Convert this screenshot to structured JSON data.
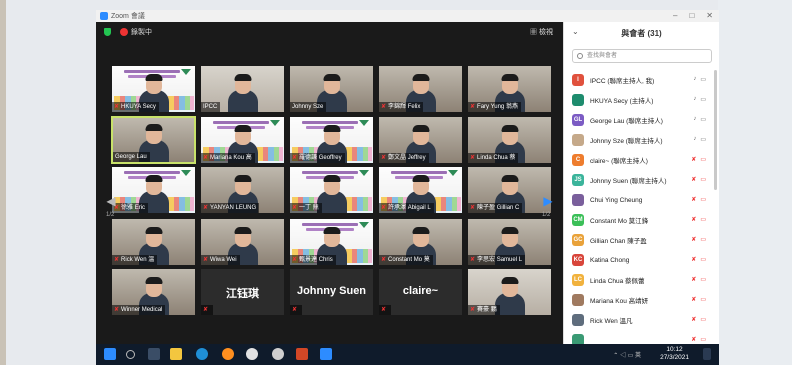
{
  "window": {
    "title": "Zoom 會議"
  },
  "toolbar": {
    "recording_label": "錄製中",
    "view_label": "檢視"
  },
  "pager": {
    "left": "1/2",
    "right": "1/2"
  },
  "tiles": [
    {
      "name": "HKUYA Secy",
      "muted": true,
      "kind": "slide"
    },
    {
      "name": "IPCC",
      "muted": false,
      "kind": "office"
    },
    {
      "name": "Johnny Sze",
      "muted": false,
      "kind": "person"
    },
    {
      "name": "李錦輝 Felix",
      "muted": true,
      "kind": "person"
    },
    {
      "name": "Fary Yung 翁燕",
      "muted": true,
      "kind": "person"
    },
    {
      "name": "George Lau",
      "muted": false,
      "kind": "person",
      "active": true
    },
    {
      "name": "Mariana Kou 高",
      "muted": true,
      "kind": "slide"
    },
    {
      "name": "羅德謙 Geoffrey",
      "muted": true,
      "kind": "slide"
    },
    {
      "name": "鄭文晶 Jeffrey",
      "muted": true,
      "kind": "person"
    },
    {
      "name": "Linda Chua 蔡",
      "muted": true,
      "kind": "person"
    },
    {
      "name": "徐雅 Eric",
      "muted": true,
      "kind": "slide"
    },
    {
      "name": "YANYAN LEUNG",
      "muted": true,
      "kind": "person"
    },
    {
      "name": "一丁 鼎",
      "muted": true,
      "kind": "slide"
    },
    {
      "name": "許承澤 Abigail L",
      "muted": true,
      "kind": "slide"
    },
    {
      "name": "陳子盈 Gillian C",
      "muted": true,
      "kind": "person"
    },
    {
      "name": "Rick Wen 溫",
      "muted": true,
      "kind": "person"
    },
    {
      "name": "Wiwa Wei",
      "muted": true,
      "kind": "person"
    },
    {
      "name": "甄景達 Chris",
      "muted": true,
      "kind": "slide"
    },
    {
      "name": "Constant Mo 莫",
      "muted": true,
      "kind": "person"
    },
    {
      "name": "李思宏 Samuel L",
      "muted": true,
      "kind": "person"
    },
    {
      "name": "Winner Medical",
      "muted": true,
      "kind": "person"
    },
    {
      "name": "",
      "big": "江钰琪",
      "muted": true,
      "kind": "dark"
    },
    {
      "name": "",
      "big": "Johnny Suen",
      "muted": true,
      "kind": "dark"
    },
    {
      "name": "",
      "big": "claire~",
      "muted": true,
      "kind": "dark"
    },
    {
      "name": "賽豪 鵬",
      "muted": true,
      "kind": "office"
    }
  ],
  "panel": {
    "title": "與會者 (31)",
    "search_placeholder": "查找與會者",
    "participants": [
      {
        "name": "IPCC (聯席主持人, 我)",
        "initials": "I",
        "color": "#e0513d",
        "muted": false
      },
      {
        "name": "HKUYA Secy (主持人)",
        "initials": "",
        "color": "#1e8c6e",
        "muted": false
      },
      {
        "name": "George Lau (聯席主持人)",
        "initials": "GL",
        "color": "#7c5cc4",
        "muted": false
      },
      {
        "name": "Johnny Sze (聯席主持人)",
        "initials": "",
        "color": "#c5a98a",
        "muted": false
      },
      {
        "name": "claire~ (聯席主持人)",
        "initials": "C",
        "color": "#ee7d2e",
        "muted": true
      },
      {
        "name": "Johnny Suen (聯席主持人)",
        "initials": "JS",
        "color": "#3bb49b",
        "muted": true
      },
      {
        "name": "Chui Ying Cheung",
        "initials": "",
        "color": "#7a5f9c",
        "muted": true
      },
      {
        "name": "Constant Mo 莫江鋒",
        "initials": "CM",
        "color": "#3bbf58",
        "muted": true
      },
      {
        "name": "Gillian Chan 陳子盈",
        "initials": "GC",
        "color": "#e9a23a",
        "muted": true
      },
      {
        "name": "Katina Chong",
        "initials": "KC",
        "color": "#d8463b",
        "muted": true
      },
      {
        "name": "Linda Chua 蔡佩蕾",
        "initials": "LC",
        "color": "#f1b23e",
        "muted": true
      },
      {
        "name": "Mariana Kou 高靖妍",
        "initials": "",
        "color": "#a07a60",
        "muted": true
      },
      {
        "name": "Rick Wen 溫凡",
        "initials": "",
        "color": "#5f6d7d",
        "muted": true
      },
      {
        "name": "",
        "initials": "",
        "color": "#3a9a74",
        "muted": true
      }
    ]
  },
  "taskbar": {
    "time": "10:12",
    "date": "27/3/2021",
    "lang": "英"
  }
}
